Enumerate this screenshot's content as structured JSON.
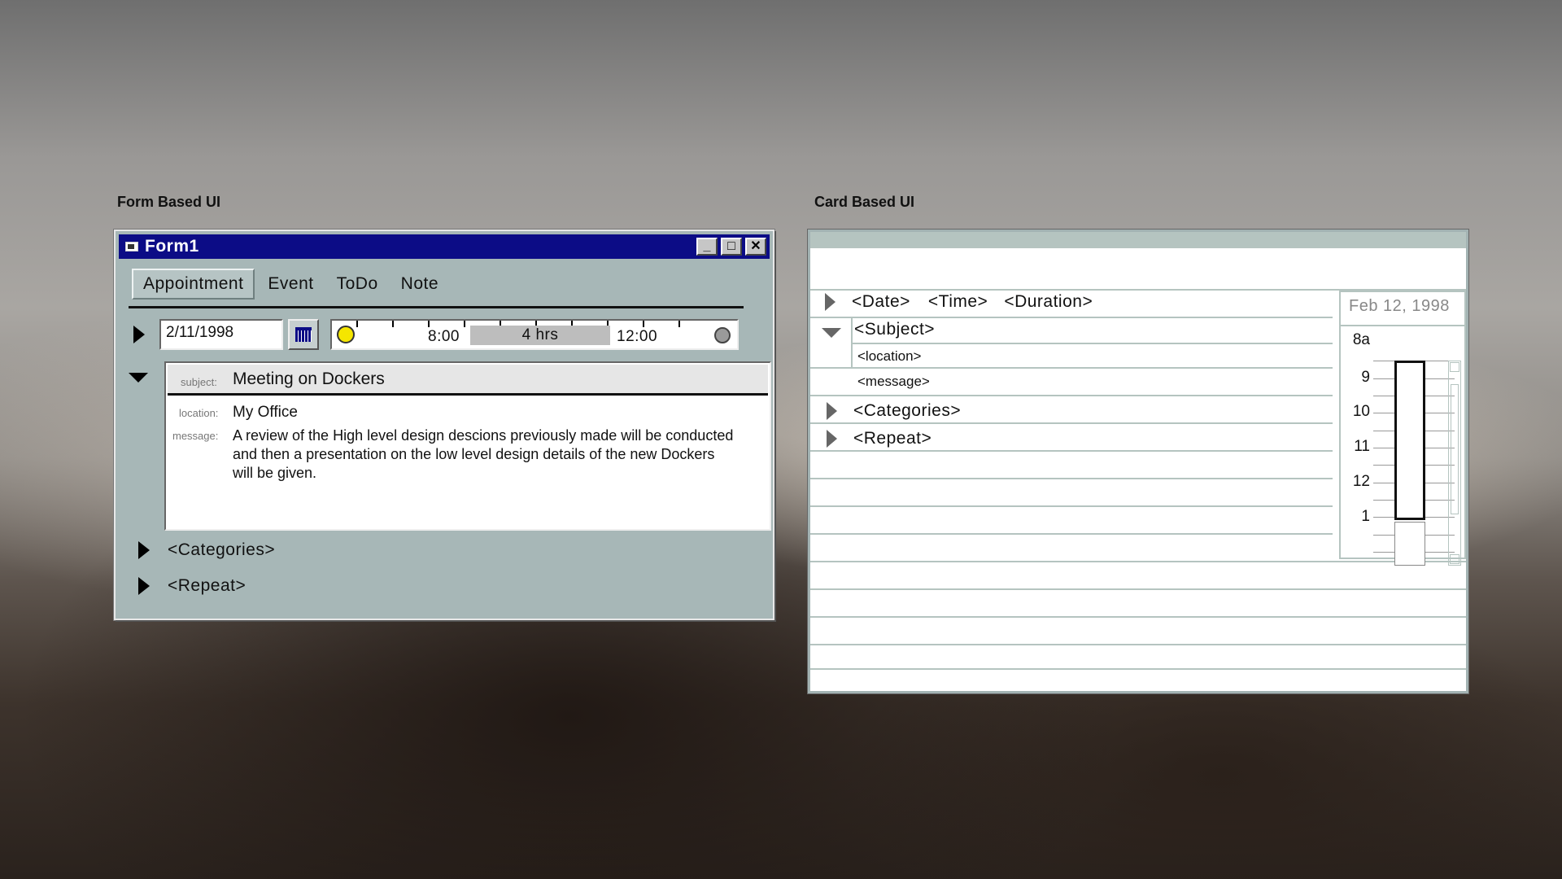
{
  "labels": {
    "form_based": "Form Based UI",
    "card_based": "Card Based UI"
  },
  "form": {
    "title": "Form1",
    "window_controls": {
      "minimize": "_",
      "maximize": "□",
      "close": "✕"
    },
    "tabs": [
      "Appointment",
      "Event",
      "ToDo",
      "Note"
    ],
    "active_tab": "Appointment",
    "date_value": "2/11/1998",
    "timeline": {
      "start": "8:00",
      "duration": "4 hrs",
      "end": "12:00"
    },
    "subject_label": "subject:",
    "subject": "Meeting on Dockers",
    "location_label": "location:",
    "location": "My Office",
    "message_label": "message:",
    "message": "A review of the High level design descions previously made will be conducted and then a presentation on the low level design details of the new Dockers will be given.",
    "categories": "<Categories>",
    "repeat": "<Repeat>"
  },
  "card": {
    "date": "<Date>",
    "time": "<Time>",
    "duration": "<Duration>",
    "subject": "<Subject>",
    "location": "<location>",
    "message": "<message>",
    "categories": "<Categories>",
    "repeat": "<Repeat>",
    "mini_calendar": {
      "date": "Feb 12, 1998",
      "hours": [
        "8a",
        "9",
        "10",
        "11",
        "12",
        "1"
      ]
    }
  },
  "icons": [
    "app-icon",
    "calendar-icon",
    "sun-icon",
    "moon-icon",
    "expand-arrow-icon",
    "collapse-arrow-icon"
  ]
}
